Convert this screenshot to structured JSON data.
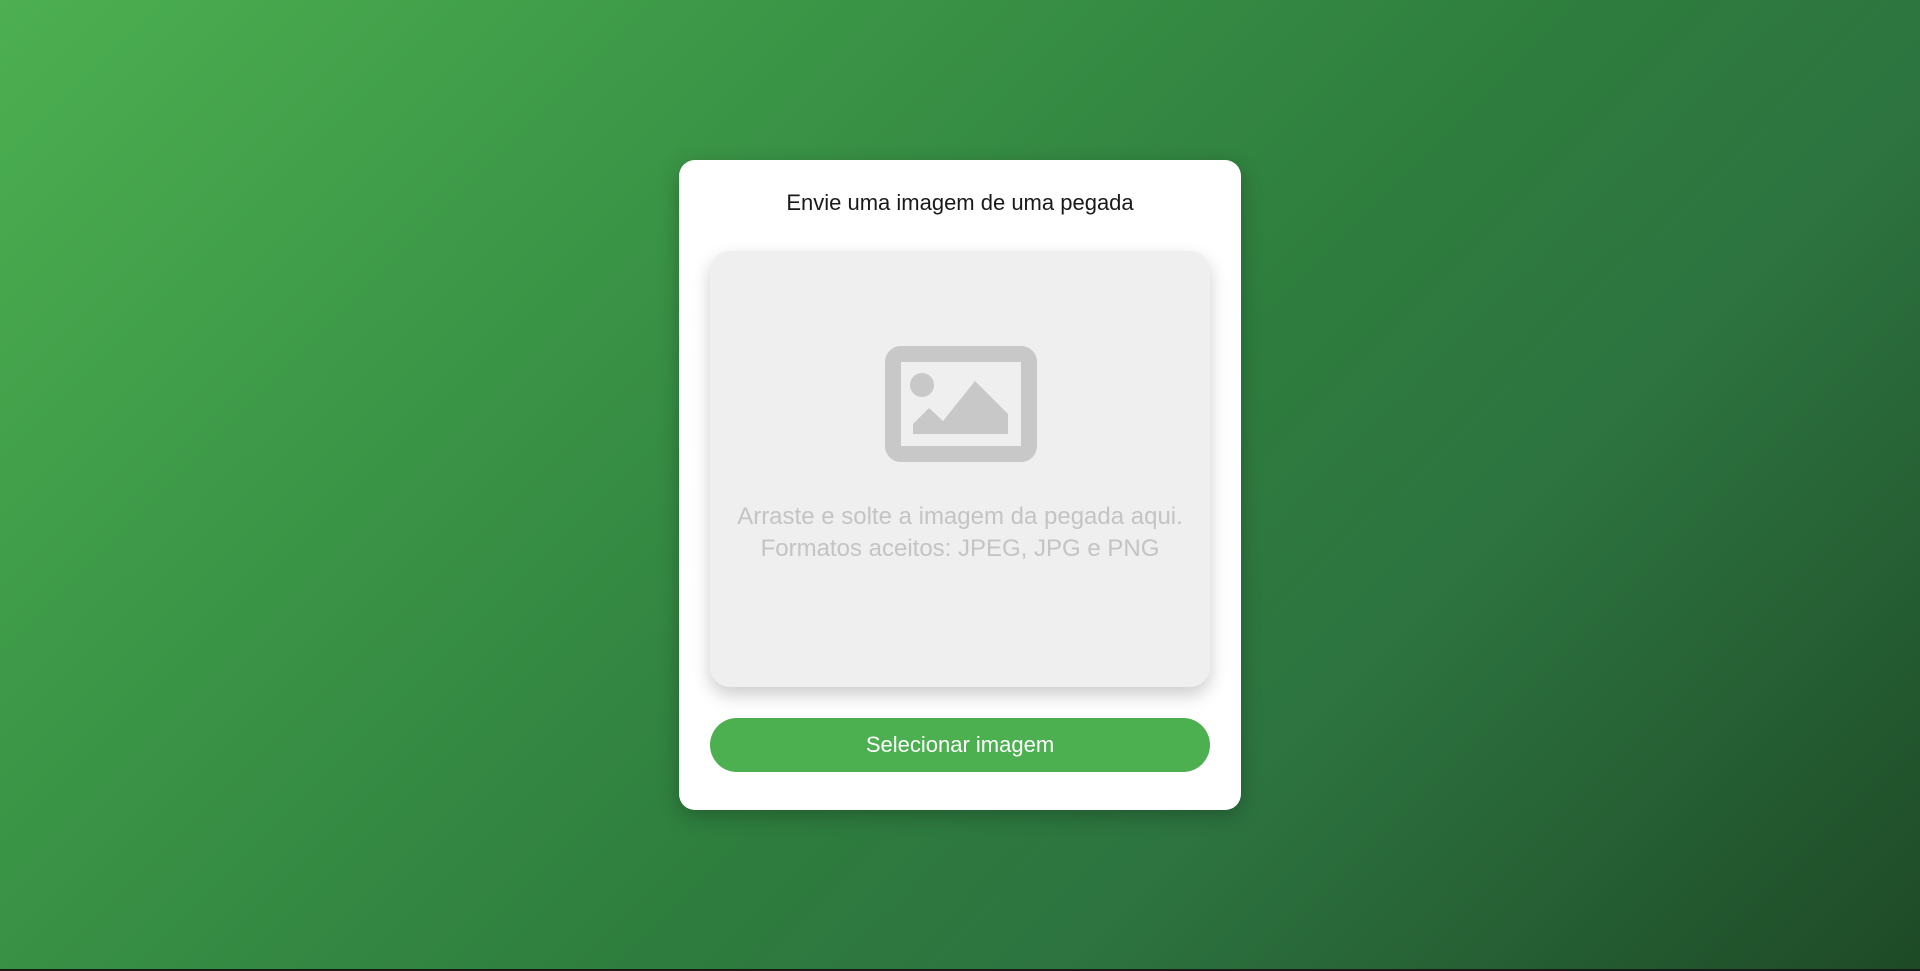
{
  "upload": {
    "title": "Envie uma imagem de uma pegada",
    "dropzone": {
      "icon": "image-icon",
      "line1": "Arraste e solte a imagem da pegada aqui.",
      "line2": "Formatos aceitos: JPEG, JPG e PNG"
    },
    "button_label": "Selecionar imagem"
  },
  "colors": {
    "accent": "#4caf50",
    "dropzone_bg": "#efefef",
    "placeholder_text": "#c4c4c4",
    "icon": "#c8c8c8"
  }
}
